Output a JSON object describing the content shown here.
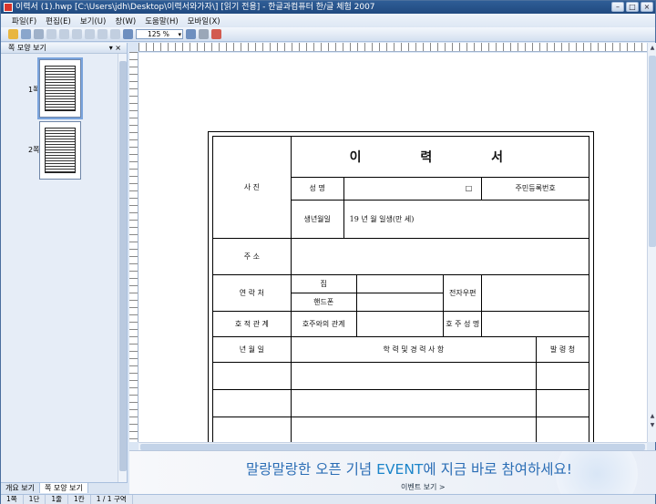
{
  "window": {
    "title": "이력서 (1).hwp [C:\\Users\\jdh\\Desktop\\이력서와가자\\] [읽기 전용] - 한글과컴퓨터 한/글 체험 2007",
    "controls": [
      "minimize",
      "maximize",
      "close"
    ]
  },
  "menu": [
    "파일(F)",
    "편집(E)",
    "보기(U)",
    "창(W)",
    "도움말(H)",
    "모바일(X)"
  ],
  "toolbar": {
    "zoom": "125 %"
  },
  "panel": {
    "title": "쪽 모양 보기",
    "pages": [
      "1쪽",
      "2쪽"
    ],
    "tabs": [
      "개요 보기",
      "쪽 모양 보기"
    ]
  },
  "form": {
    "title": "이 력 서",
    "photo": "사 진",
    "name_label": "성 명",
    "name_mark": "□",
    "id_label": "주민등록번호",
    "birth_label": "생년월일",
    "birth_value": "19 년 월 일생(만 세)",
    "address_label": "주 소",
    "contact_label": "연 락 처",
    "home_label": "집",
    "mobile_label": "핸드폰",
    "email_label": "전자우편",
    "relation_label": "호 적 관 계",
    "head_relation_label": "호주와의 관계",
    "head_name_label": "호 주 성 명",
    "date_header": "년 월 일",
    "history_header": "학 력 및 경 력 사 항",
    "issuer_header": "발 령 청"
  },
  "banner": {
    "main_pre": "말랑말랑한 오픈 기념 ",
    "main_event": "EVENT",
    "main_post": "에 지금 바로 참여하세요!",
    "link": "이벤트 보기 >"
  },
  "status": [
    "1쪽",
    "1단",
    "1줄",
    "1칸",
    "1 / 1 구역"
  ]
}
